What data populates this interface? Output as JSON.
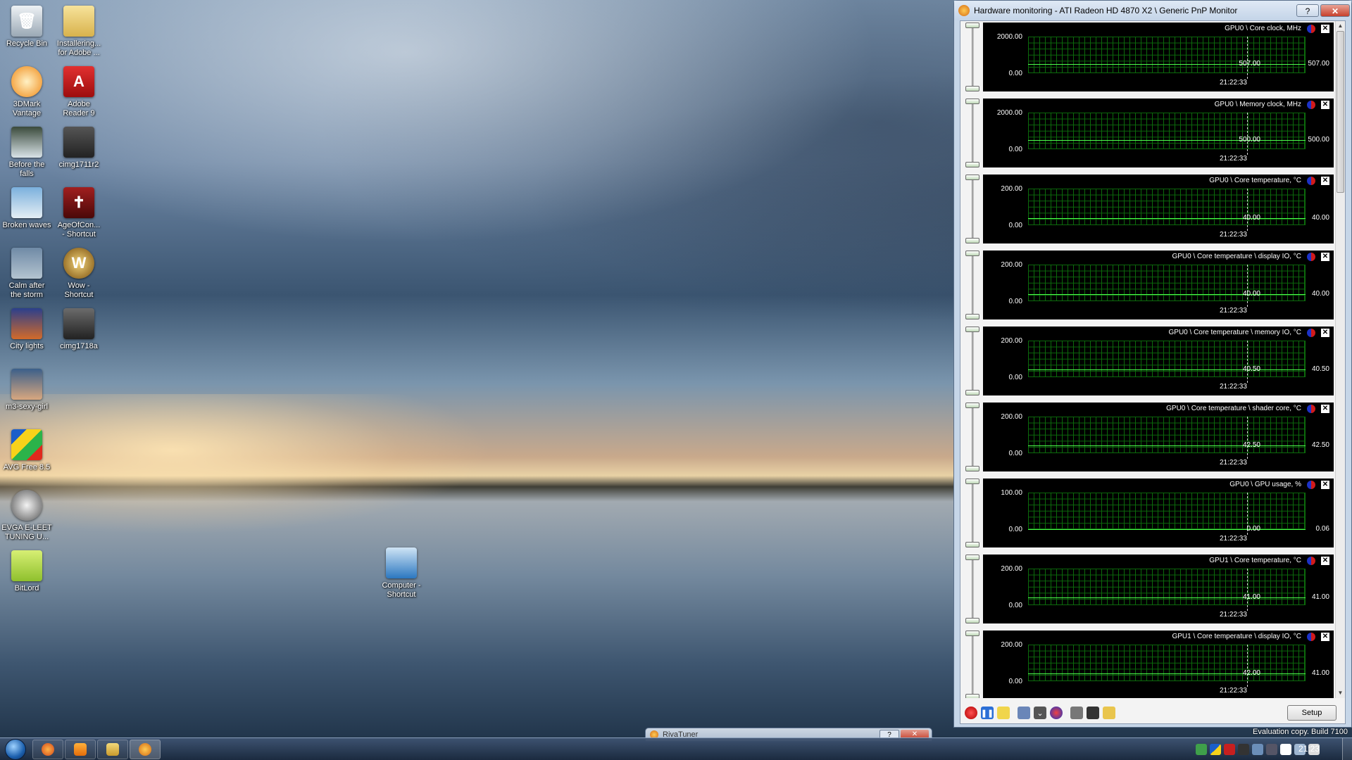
{
  "desktop": {
    "icons": [
      {
        "label": "Recycle Bin"
      },
      {
        "label": "Installering...\nfor Adobe ..."
      },
      {
        "label": "3DMark\nVantage"
      },
      {
        "label": "Adobe\nReader 9"
      },
      {
        "label": "Before the\nfalls"
      },
      {
        "label": "cimg1711r2"
      },
      {
        "label": "Broken waves"
      },
      {
        "label": "AgeOfCon...\n- Shortcut"
      },
      {
        "label": "Calm after\nthe storm"
      },
      {
        "label": "Wow -\nShortcut"
      },
      {
        "label": "City lights"
      },
      {
        "label": "cimg1718a"
      },
      {
        "label": "m3-sexy-girl"
      },
      {
        "label": "AVG Free 8.5"
      },
      {
        "label": "EVGA E-LEET\nTUNING U..."
      },
      {
        "label": "BitLord"
      },
      {
        "label": "Computer -\nShortcut"
      }
    ]
  },
  "monitor_window": {
    "title": "Hardware monitoring - ATI Radeon HD 4870 X2 \\ Generic PnP Monitor",
    "help_button": "?",
    "close_button": "✕",
    "setup_button": "Setup",
    "graphs": [
      {
        "title": "GPU0 \\ Core clock, MHz",
        "ymax": "2000.00",
        "ymin": "0.00",
        "cursor_value": "507.00",
        "current_value": "507.00",
        "time": "21:22:33",
        "level": 0.2535,
        "color": "#4cff4c"
      },
      {
        "title": "GPU0 \\ Memory clock, MHz",
        "ymax": "2000.00",
        "ymin": "0.00",
        "cursor_value": "500.00",
        "current_value": "500.00",
        "time": "21:22:33",
        "level": 0.25,
        "color": "#4cff4c"
      },
      {
        "title": "GPU0 \\ Core temperature, °C",
        "ymax": "200.00",
        "ymin": "0.00",
        "cursor_value": "40.00",
        "current_value": "40.00",
        "time": "21:22:33",
        "level": 0.2,
        "color": "#4cff4c"
      },
      {
        "title": "GPU0 \\ Core temperature \\ display IO, °C",
        "ymax": "200.00",
        "ymin": "0.00",
        "cursor_value": "40.00",
        "current_value": "40.00",
        "time": "21:22:33",
        "level": 0.2,
        "color": "#4cff4c"
      },
      {
        "title": "GPU0 \\ Core temperature \\ memory IO, °C",
        "ymax": "200.00",
        "ymin": "0.00",
        "cursor_value": "40.50",
        "current_value": "40.50",
        "time": "21:22:33",
        "level": 0.2025,
        "color": "#4cff4c"
      },
      {
        "title": "GPU0 \\ Core temperature \\ shader core, °C",
        "ymax": "200.00",
        "ymin": "0.00",
        "cursor_value": "42.50",
        "current_value": "42.50",
        "time": "21:22:33",
        "level": 0.2125,
        "color": "#4cff4c"
      },
      {
        "title": "GPU0 \\ GPU usage, %",
        "ymax": "100.00",
        "ymin": "0.00",
        "cursor_value": "0.00",
        "current_value": "0.06",
        "time": "21:22:33",
        "level": 0.0,
        "color": "#4cff4c"
      },
      {
        "title": "GPU1 \\ Core temperature, °C",
        "ymax": "200.00",
        "ymin": "0.00",
        "cursor_value": "41.00",
        "current_value": "41.00",
        "time": "21:22:33",
        "level": 0.205,
        "color": "#4cff4c"
      },
      {
        "title": "GPU1 \\ Core temperature \\ display IO, °C",
        "ymax": "200.00",
        "ymin": "0.00",
        "cursor_value": "42.00",
        "current_value": "41.00",
        "time": "21:22:33",
        "level": 0.21,
        "color": "#4cff4c"
      }
    ],
    "toolbar_icons": [
      "record-icon",
      "pause-icon",
      "wand-icon",
      "windows-icon",
      "filter-icon",
      "ati-icon",
      "print-icon",
      "save-icon",
      "folder-icon"
    ]
  },
  "rivatuner_window": {
    "title": "RivaTuner",
    "help_button": "?",
    "close_button": "✕"
  },
  "watermark": "Evaluation copy. Build 7100",
  "taskbar": {
    "clock": "21:23",
    "pinned": [
      "firefox-icon",
      "media-player-icon",
      "explorer-icon",
      "rivatuner-icon"
    ]
  }
}
